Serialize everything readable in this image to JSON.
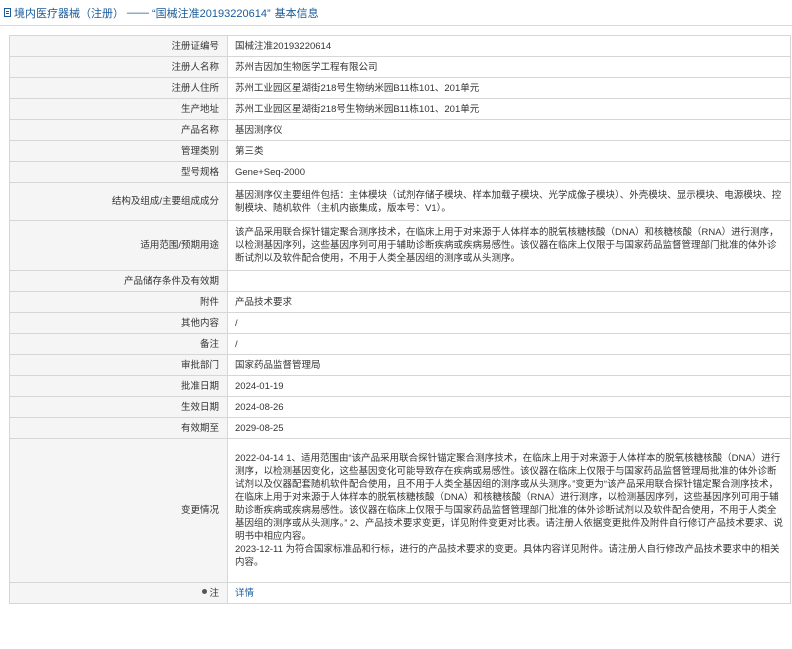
{
  "header": {
    "category_link": "境内医疗器械（注册）",
    "separator": "——",
    "title": "“国械注准20193220614”",
    "suffix": "基本信息"
  },
  "rows": [
    {
      "label": "注册证编号",
      "value": "国械注准20193220614"
    },
    {
      "label": "注册人名称",
      "value": "苏州吉因加生物医学工程有限公司"
    },
    {
      "label": "注册人住所",
      "value": "苏州工业园区星湖街218号生物纳米园B11栋101、201单元"
    },
    {
      "label": "生产地址",
      "value": "苏州工业园区星湖街218号生物纳米园B11栋101、201单元"
    },
    {
      "label": "产品名称",
      "value": "基因测序仪"
    },
    {
      "label": "管理类别",
      "value": "第三类"
    },
    {
      "label": "型号规格",
      "value": "Gene+Seq-2000"
    },
    {
      "label": "结构及组成/主要组成成分",
      "value": "基因测序仪主要组件包括：主体模块（试剂存储子模块、样本加载子模块、光学成像子模块）、外壳模块、显示模块、电源模块、控制模块、随机软件（主机内嵌集成，版本号：V1）。"
    },
    {
      "label": "适用范围/预期用途",
      "value": "该产品采用联合探针锚定聚合测序技术，在临床上用于对来源于人体样本的脱氧核糖核酸（DNA）和核糖核酸（RNA）进行测序，以检测基因序列，这些基因序列可用于辅助诊断疾病或疾病易感性。该仪器在临床上仅限于与国家药品监督管理部门批准的体外诊断试剂以及软件配合使用，不用于人类全基因组的测序或从头测序。"
    },
    {
      "label": "产品储存条件及有效期",
      "value": ""
    },
    {
      "label": "附件",
      "value": "产品技术要求"
    },
    {
      "label": "其他内容",
      "value": "/"
    },
    {
      "label": "备注",
      "value": "/"
    },
    {
      "label": "审批部门",
      "value": "国家药品监督管理局"
    },
    {
      "label": "批准日期",
      "value": "2024-01-19"
    },
    {
      "label": "生效日期",
      "value": "2024-08-26"
    },
    {
      "label": "有效期至",
      "value": "2029-08-25"
    }
  ],
  "change": {
    "label": "变更情况",
    "entry1": "2022-04-14 1、适用范围由“该产品采用联合探针锚定聚合测序技术，在临床上用于对来源于人体样本的脱氧核糖核酸（DNA）进行测序，以检测基因变化，这些基因变化可能导致存在疾病或易感性。该仪器在临床上仅限于与国家药品监督管理局批准的体外诊断试剂以及仪器配套随机软件配合使用，且不用于人类全基因组的测序或从头测序。”变更为“该产品采用联合探针锚定聚合测序技术，在临床上用于对来源于人体样本的脱氧核糖核酸（DNA）和核糖核酸（RNA）进行测序，以检测基因序列，这些基因序列可用于辅助诊断疾病或疾病易感性。该仪器在临床上仅限于与国家药品监督管理部门批准的体外诊断试剂以及软件配合使用，不用于人类全基因组的测序或从头测序。” 2、产品技术要求变更，详见附件变更对比表。请注册人依据变更批件及附件自行修订产品技术要求、说明书中相应内容。",
    "entry2": "2023-12-11 为符合国家标准品和行标，进行的产品技术要求的变更。具体内容详见附件。请注册人自行修改产品技术要求中的相关内容。"
  },
  "notes": {
    "label": "注",
    "link": "详情"
  },
  "colors": {
    "link": "#1a5b9a",
    "label_bg": "#f5f5f5",
    "border": "#d6d6d6"
  }
}
